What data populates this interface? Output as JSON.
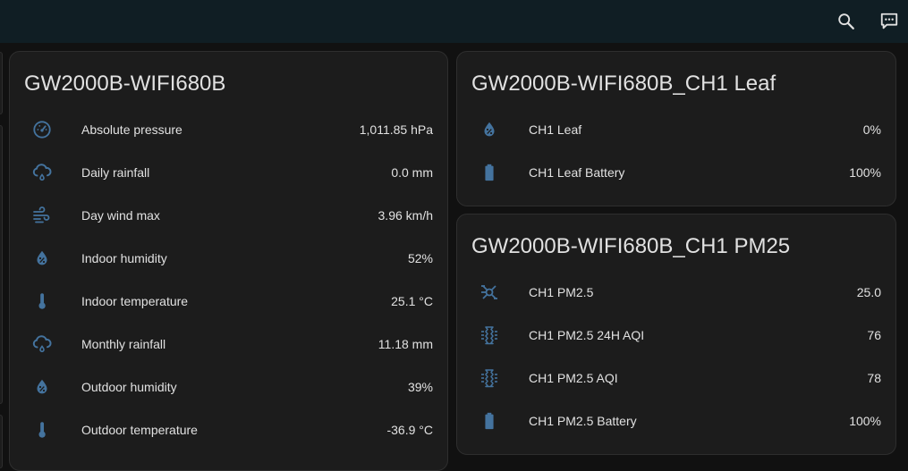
{
  "toolbar": {
    "search_icon": "magnify-icon",
    "assist_icon": "comment-processing-icon"
  },
  "colors": {
    "icon": "#44739e",
    "card_bg": "#1c1c1c",
    "header_bg": "#101e24",
    "page_bg": "#111111"
  },
  "cards": {
    "main": {
      "title": "GW2000B-WIFI680B",
      "rows": [
        {
          "label": "Absolute pressure",
          "value": "1,011.85 hPa",
          "icon": "gauge-icon"
        },
        {
          "label": "Daily rainfall",
          "value": "0.0 mm",
          "icon": "weather-rainy-icon"
        },
        {
          "label": "Day wind max",
          "value": "3.96 km/h",
          "icon": "weather-windy-icon"
        },
        {
          "label": "Indoor humidity",
          "value": "52%",
          "icon": "water-percent-icon"
        },
        {
          "label": "Indoor temperature",
          "value": "25.1 °C",
          "icon": "thermometer-icon"
        },
        {
          "label": "Monthly rainfall",
          "value": "11.18 mm",
          "icon": "weather-rainy-icon"
        },
        {
          "label": "Outdoor humidity",
          "value": "39%",
          "icon": "water-percent-icon"
        },
        {
          "label": "Outdoor temperature",
          "value": "-36.9 °C",
          "icon": "thermometer-icon"
        }
      ]
    },
    "leaf": {
      "title": "GW2000B-WIFI680B_CH1 Leaf",
      "rows": [
        {
          "label": "CH1 Leaf",
          "value": "0%",
          "icon": "water-percent-icon"
        },
        {
          "label": "CH1 Leaf Battery",
          "value": "100%",
          "icon": "battery-icon"
        }
      ]
    },
    "pm25": {
      "title": "GW2000B-WIFI680B_CH1 PM25",
      "rows": [
        {
          "label": "CH1 PM2.5",
          "value": "25.0",
          "icon": "molecule-icon"
        },
        {
          "label": "CH1 PM2.5 24H AQI",
          "value": "76",
          "icon": "air-filter-icon"
        },
        {
          "label": "CH1 PM2.5 AQI",
          "value": "78",
          "icon": "air-filter-icon"
        },
        {
          "label": "CH1 PM2.5 Battery",
          "value": "100%",
          "icon": "battery-icon"
        }
      ]
    }
  }
}
